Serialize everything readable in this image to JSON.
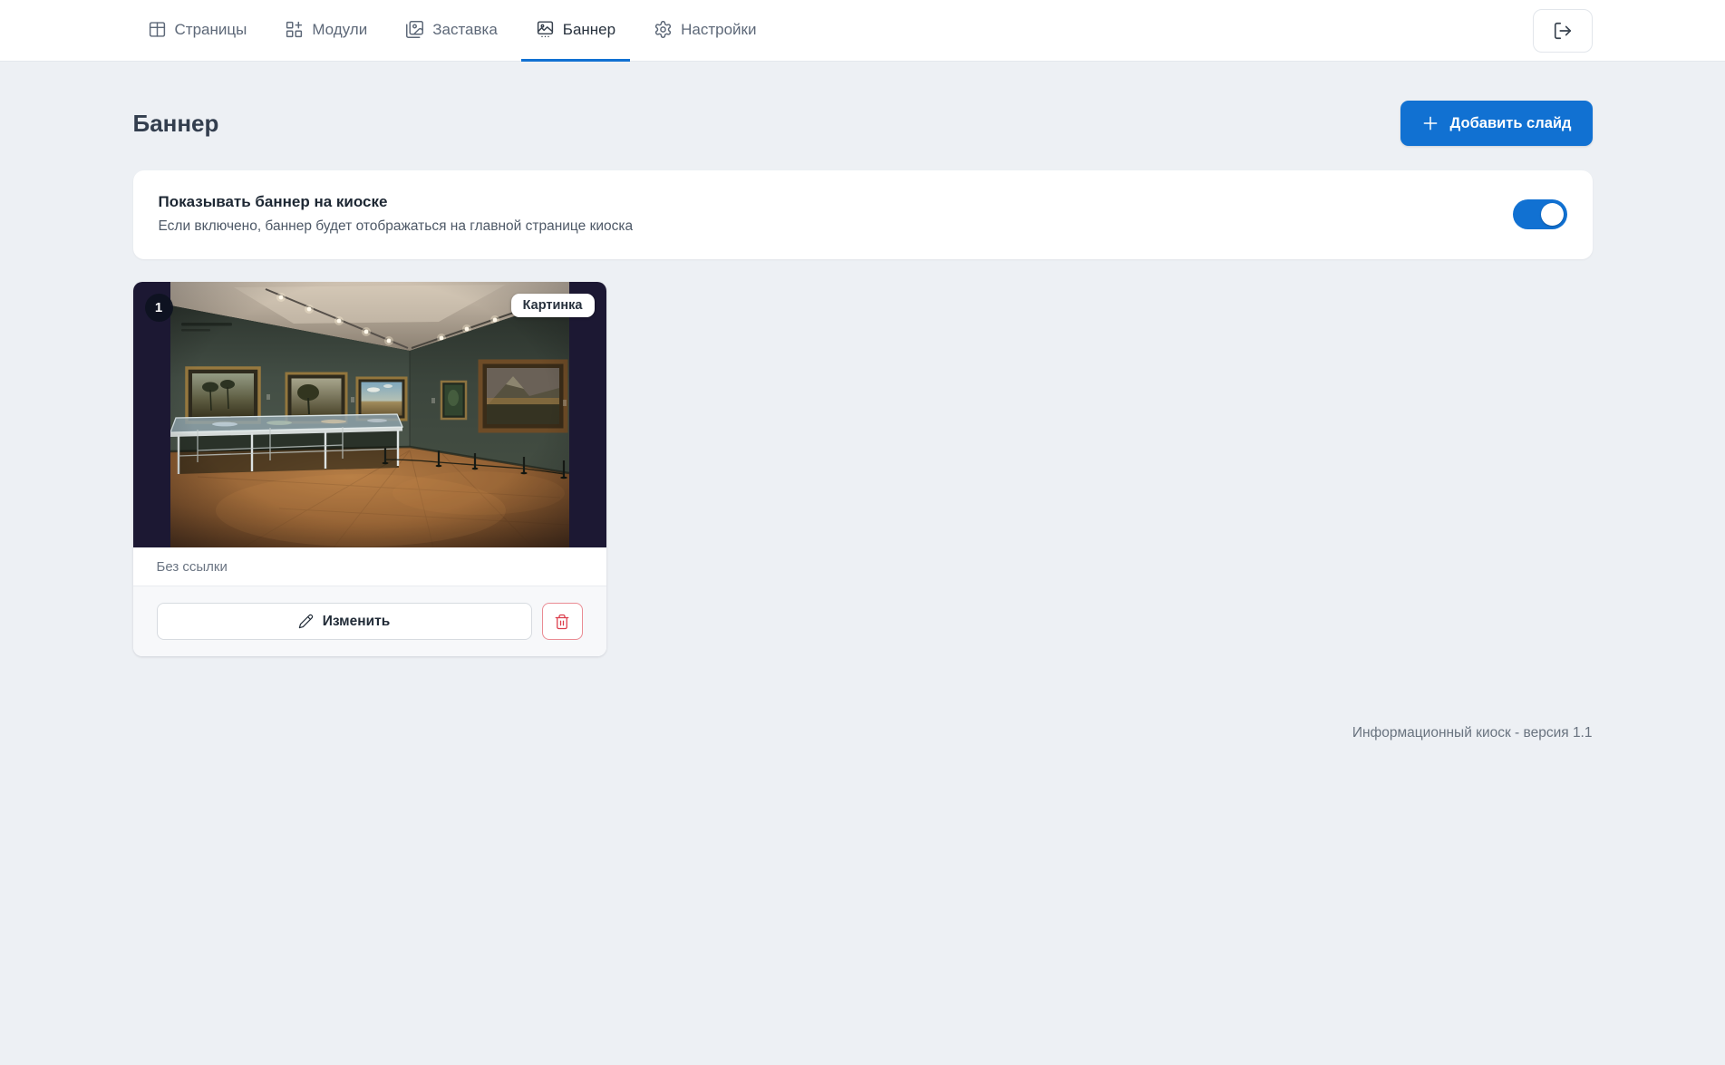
{
  "nav": {
    "tabs": [
      {
        "label": "Страницы",
        "icon": "table-icon",
        "active": false
      },
      {
        "label": "Модули",
        "icon": "modules-plus-icon",
        "active": false
      },
      {
        "label": "Заставка",
        "icon": "images-icon",
        "active": false
      },
      {
        "label": "Баннер",
        "icon": "banner-carousel-icon",
        "active": true
      },
      {
        "label": "Настройки",
        "icon": "gear-icon",
        "active": false
      }
    ],
    "logout": {
      "icon": "logout-icon"
    }
  },
  "page": {
    "title": "Баннер",
    "add_slide_label": "Добавить слайд"
  },
  "visibility_card": {
    "title": "Показывать баннер на киоске",
    "description": "Если включено, баннер будет отображаться на главной странице киоска",
    "toggle_on": true
  },
  "slide": {
    "position": "1",
    "type_label": "Картинка",
    "link_label": "Без ссылки",
    "edit_label": "Изменить",
    "image_description": "Музейный зал с картинами в золотых рамах"
  },
  "footer": {
    "version": "Информационный киоск - версия 1.1"
  },
  "colors": {
    "accent": "#1171d2",
    "danger": "#dc3d4b",
    "page_bg": "#edf0f4",
    "slide_media_bg": "#1c1833"
  }
}
